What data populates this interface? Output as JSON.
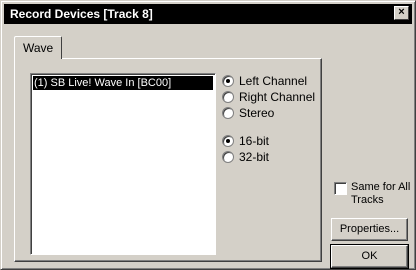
{
  "window": {
    "title": "Record Devices [Track 8]",
    "close_glyph": "×"
  },
  "tabs": [
    {
      "label": "Wave",
      "selected": true
    }
  ],
  "device_list": {
    "items": [
      {
        "label": "(1) SB Live! Wave In [BC00]",
        "selected": true
      }
    ]
  },
  "channel_options": [
    {
      "label": "Left Channel",
      "checked": true
    },
    {
      "label": "Right Channel",
      "checked": false
    },
    {
      "label": "Stereo",
      "checked": false
    }
  ],
  "bit_depth_options": [
    {
      "label": "16-bit",
      "checked": true
    },
    {
      "label": "32-bit",
      "checked": false
    }
  ],
  "same_for_all": {
    "label": "Same for All Tracks",
    "checked": false
  },
  "buttons": {
    "properties": "Properties...",
    "ok": "OK"
  }
}
